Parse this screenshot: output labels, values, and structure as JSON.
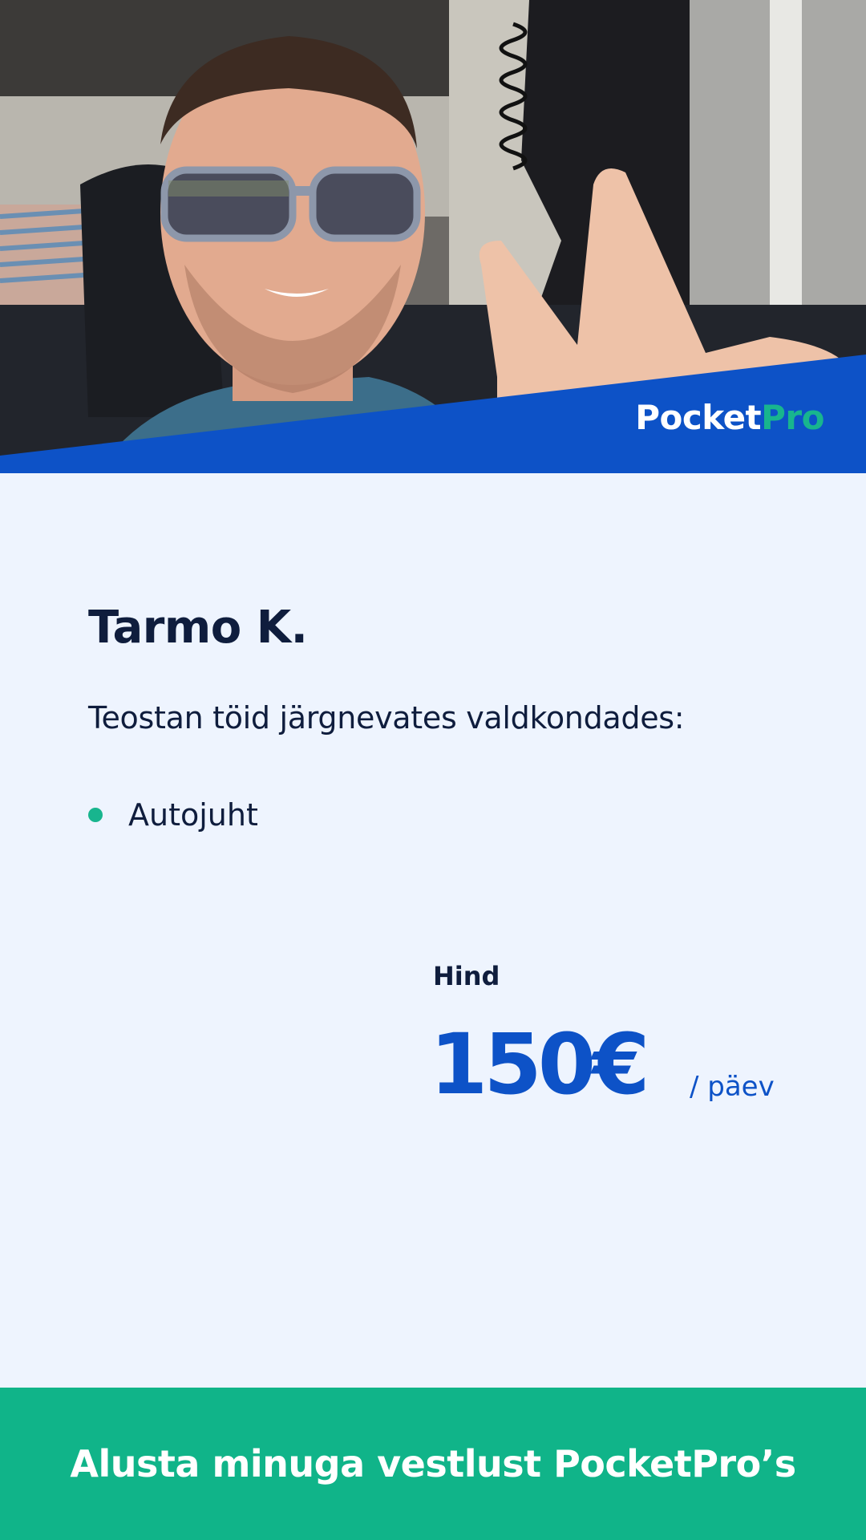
{
  "brand": {
    "logo_part1": "Pocket",
    "logo_part2": "Pro",
    "primary_color": "#0d52c7",
    "accent_color": "#18b58e"
  },
  "profile": {
    "name": "Tarmo K.",
    "intro": "Teostan töid järgnevates valdkondades:",
    "skills": [
      {
        "label": "Autojuht"
      }
    ]
  },
  "price": {
    "label": "Hind",
    "value": "150€",
    "unit": "/ päev"
  },
  "cta": {
    "label": "Alusta minuga vestlust PocketPro’s"
  }
}
